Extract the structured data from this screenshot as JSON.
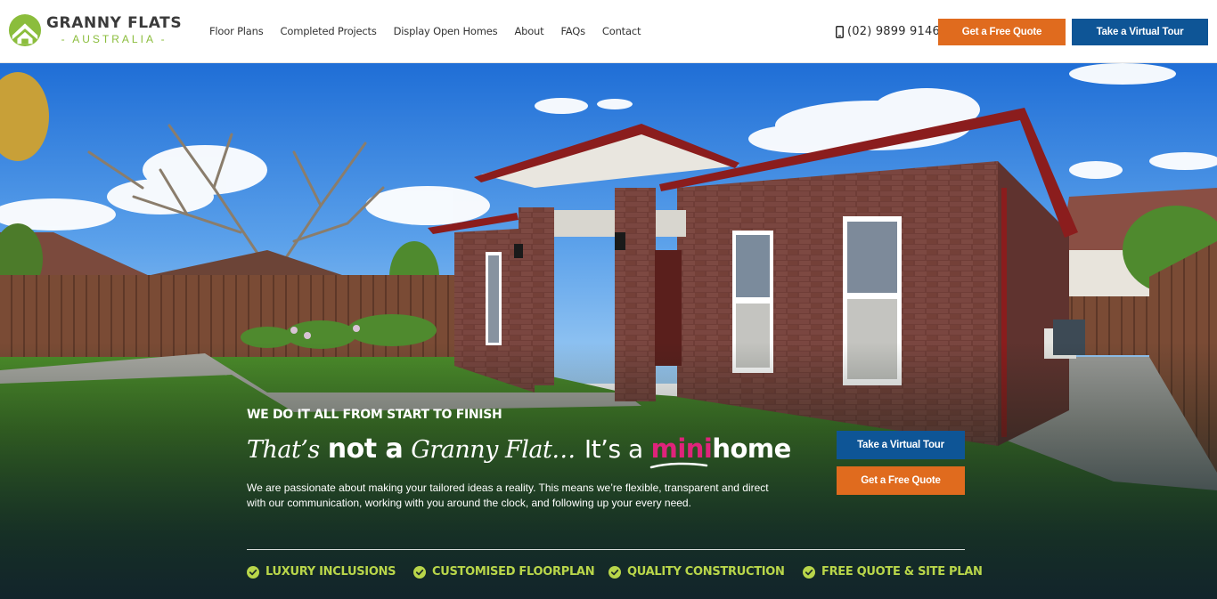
{
  "brand": {
    "name_line1": "GRANNY FLATS",
    "name_line2": "- AUSTRALIA -",
    "logo_icon": "house-roof-logo-icon",
    "green": "#8bbd3c"
  },
  "nav": {
    "items": [
      {
        "label": "Floor Plans"
      },
      {
        "label": "Completed Projects"
      },
      {
        "label": "Display Open Homes"
      },
      {
        "label": "About"
      },
      {
        "label": "FAQs"
      },
      {
        "label": "Contact"
      }
    ]
  },
  "header": {
    "phone": "(02) 9899 9146",
    "phone_icon": "mobile-phone-icon",
    "quote_button": "Get a Free Quote",
    "tour_button": "Take a Virtual Tour"
  },
  "hero": {
    "eyebrow": "WE DO IT ALL FROM START TO FINISH",
    "headline": {
      "part1": "That’s",
      "part2": "not a",
      "part3": "Granny Flat…",
      "part4": "It’s a",
      "part5_highlight": "mini",
      "part6": "home"
    },
    "intro": "We are passionate about making your tailored ideas a reality. This means we’re flexible, transparent and direct with our communication, working with you around the clock, and following up your every need.",
    "tour_button": "Take a Virtual Tour",
    "quote_button": "Get a Free Quote",
    "features": [
      {
        "label": "LUXURY INCLUSIONS",
        "icon": "check-circle-icon"
      },
      {
        "label": "CUSTOMISED FLOORPLAN",
        "icon": "check-circle-icon"
      },
      {
        "label": "QUALITY CONSTRUCTION",
        "icon": "check-circle-icon"
      },
      {
        "label": "FREE QUOTE & SITE PLAN",
        "icon": "check-circle-icon"
      }
    ]
  },
  "colors": {
    "orange": "#e06b1e",
    "blue": "#0e5596",
    "accent_pink": "#e0237b",
    "feature_green": "#b9d64a"
  }
}
